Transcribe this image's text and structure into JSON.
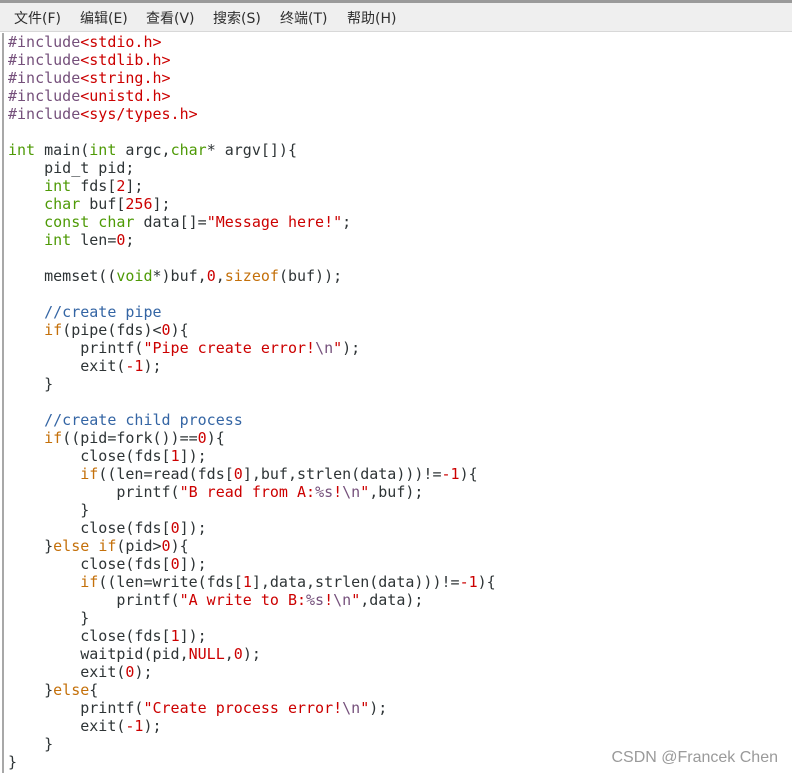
{
  "menu": [
    "文件(F)",
    "编辑(E)",
    "查看(V)",
    "搜索(S)",
    "终端(T)",
    "帮助(H)"
  ],
  "watermark": "CSDN @Francek Chen",
  "colors": {
    "keyword": "#4e9a06",
    "control": "#c4700a",
    "string": "#cc0000",
    "preprocessor": "#75507b",
    "comment": "#3465a4"
  },
  "code": [
    [
      [
        "p",
        "#include"
      ],
      [
        "s",
        "<stdio.h>"
      ]
    ],
    [
      [
        "p",
        "#include"
      ],
      [
        "s",
        "<stdlib.h>"
      ]
    ],
    [
      [
        "p",
        "#include"
      ],
      [
        "s",
        "<string.h>"
      ]
    ],
    [
      [
        "p",
        "#include"
      ],
      [
        "s",
        "<unistd.h>"
      ]
    ],
    [
      [
        "p",
        "#include"
      ],
      [
        "s",
        "<sys/types.h>"
      ]
    ],
    [],
    [
      [
        "k",
        "int"
      ],
      [
        "t",
        " main("
      ],
      [
        "k",
        "int"
      ],
      [
        "t",
        " argc,"
      ],
      [
        "k",
        "char"
      ],
      [
        "t",
        "* argv[]){"
      ]
    ],
    [
      [
        "t",
        "    pid_t pid;"
      ]
    ],
    [
      [
        "t",
        "    "
      ],
      [
        "k",
        "int"
      ],
      [
        "t",
        " fds["
      ],
      [
        "n",
        "2"
      ],
      [
        "t",
        "];"
      ]
    ],
    [
      [
        "t",
        "    "
      ],
      [
        "k",
        "char"
      ],
      [
        "t",
        " buf["
      ],
      [
        "n",
        "256"
      ],
      [
        "t",
        "];"
      ]
    ],
    [
      [
        "t",
        "    "
      ],
      [
        "k",
        "const char"
      ],
      [
        "t",
        " data[]="
      ],
      [
        "s",
        "\"Message here!\""
      ],
      [
        "t",
        ";"
      ]
    ],
    [
      [
        "t",
        "    "
      ],
      [
        "k",
        "int"
      ],
      [
        "t",
        " len="
      ],
      [
        "n",
        "0"
      ],
      [
        "t",
        ";"
      ]
    ],
    [],
    [
      [
        "t",
        "    memset(("
      ],
      [
        "k",
        "void"
      ],
      [
        "t",
        "*)buf,"
      ],
      [
        "n",
        "0"
      ],
      [
        "t",
        ","
      ],
      [
        "c",
        "sizeof"
      ],
      [
        "t",
        "(buf));"
      ]
    ],
    [],
    [
      [
        "t",
        "    "
      ],
      [
        "m",
        "//create pipe"
      ]
    ],
    [
      [
        "t",
        "    "
      ],
      [
        "c",
        "if"
      ],
      [
        "t",
        "(pipe(fds)<"
      ],
      [
        "n",
        "0"
      ],
      [
        "t",
        "){"
      ]
    ],
    [
      [
        "t",
        "        printf("
      ],
      [
        "s",
        "\"Pipe create error!"
      ],
      [
        "e",
        "\\n"
      ],
      [
        "s",
        "\""
      ],
      [
        "t",
        ");"
      ]
    ],
    [
      [
        "t",
        "        exit("
      ],
      [
        "n",
        "-1"
      ],
      [
        "t",
        ");"
      ]
    ],
    [
      [
        "t",
        "    }"
      ]
    ],
    [],
    [
      [
        "t",
        "    "
      ],
      [
        "m",
        "//create child process"
      ]
    ],
    [
      [
        "t",
        "    "
      ],
      [
        "c",
        "if"
      ],
      [
        "t",
        "((pid=fork())=="
      ],
      [
        "n",
        "0"
      ],
      [
        "t",
        "){"
      ]
    ],
    [
      [
        "t",
        "        close(fds["
      ],
      [
        "n",
        "1"
      ],
      [
        "t",
        "]);"
      ]
    ],
    [
      [
        "t",
        "        "
      ],
      [
        "c",
        "if"
      ],
      [
        "t",
        "((len=read(fds["
      ],
      [
        "n",
        "0"
      ],
      [
        "t",
        "],buf,strlen(data)))!="
      ],
      [
        "n",
        "-1"
      ],
      [
        "t",
        "){"
      ]
    ],
    [
      [
        "t",
        "            printf("
      ],
      [
        "s",
        "\"B read from A:"
      ],
      [
        "e",
        "%s"
      ],
      [
        "s",
        "!"
      ],
      [
        "e",
        "\\n"
      ],
      [
        "s",
        "\""
      ],
      [
        "t",
        ",buf);"
      ]
    ],
    [
      [
        "t",
        "        }"
      ]
    ],
    [
      [
        "t",
        "        close(fds["
      ],
      [
        "n",
        "0"
      ],
      [
        "t",
        "]);"
      ]
    ],
    [
      [
        "t",
        "    }"
      ],
      [
        "c",
        "else"
      ],
      [
        "t",
        " "
      ],
      [
        "c",
        "if"
      ],
      [
        "t",
        "(pid>"
      ],
      [
        "n",
        "0"
      ],
      [
        "t",
        "){"
      ]
    ],
    [
      [
        "t",
        "        close(fds["
      ],
      [
        "n",
        "0"
      ],
      [
        "t",
        "]);"
      ]
    ],
    [
      [
        "t",
        "        "
      ],
      [
        "c",
        "if"
      ],
      [
        "t",
        "((len=write(fds["
      ],
      [
        "n",
        "1"
      ],
      [
        "t",
        "],data,strlen(data)))!="
      ],
      [
        "n",
        "-1"
      ],
      [
        "t",
        "){"
      ]
    ],
    [
      [
        "t",
        "            printf("
      ],
      [
        "s",
        "\"A write to B:"
      ],
      [
        "e",
        "%s"
      ],
      [
        "s",
        "!"
      ],
      [
        "e",
        "\\n"
      ],
      [
        "s",
        "\""
      ],
      [
        "t",
        ",data);"
      ]
    ],
    [
      [
        "t",
        "        }"
      ]
    ],
    [
      [
        "t",
        "        close(fds["
      ],
      [
        "n",
        "1"
      ],
      [
        "t",
        "]);"
      ]
    ],
    [
      [
        "t",
        "        waitpid(pid,"
      ],
      [
        "n",
        "NULL"
      ],
      [
        "t",
        ","
      ],
      [
        "n",
        "0"
      ],
      [
        "t",
        ");"
      ]
    ],
    [
      [
        "t",
        "        exit("
      ],
      [
        "n",
        "0"
      ],
      [
        "t",
        ");"
      ]
    ],
    [
      [
        "t",
        "    }"
      ],
      [
        "c",
        "else"
      ],
      [
        "t",
        "{"
      ]
    ],
    [
      [
        "t",
        "        printf("
      ],
      [
        "s",
        "\"Create process error!"
      ],
      [
        "e",
        "\\n"
      ],
      [
        "s",
        "\""
      ],
      [
        "t",
        ");"
      ]
    ],
    [
      [
        "t",
        "        exit("
      ],
      [
        "n",
        "-1"
      ],
      [
        "t",
        ");"
      ]
    ],
    [
      [
        "t",
        "    }"
      ]
    ],
    [
      [
        "t",
        "}"
      ]
    ]
  ]
}
